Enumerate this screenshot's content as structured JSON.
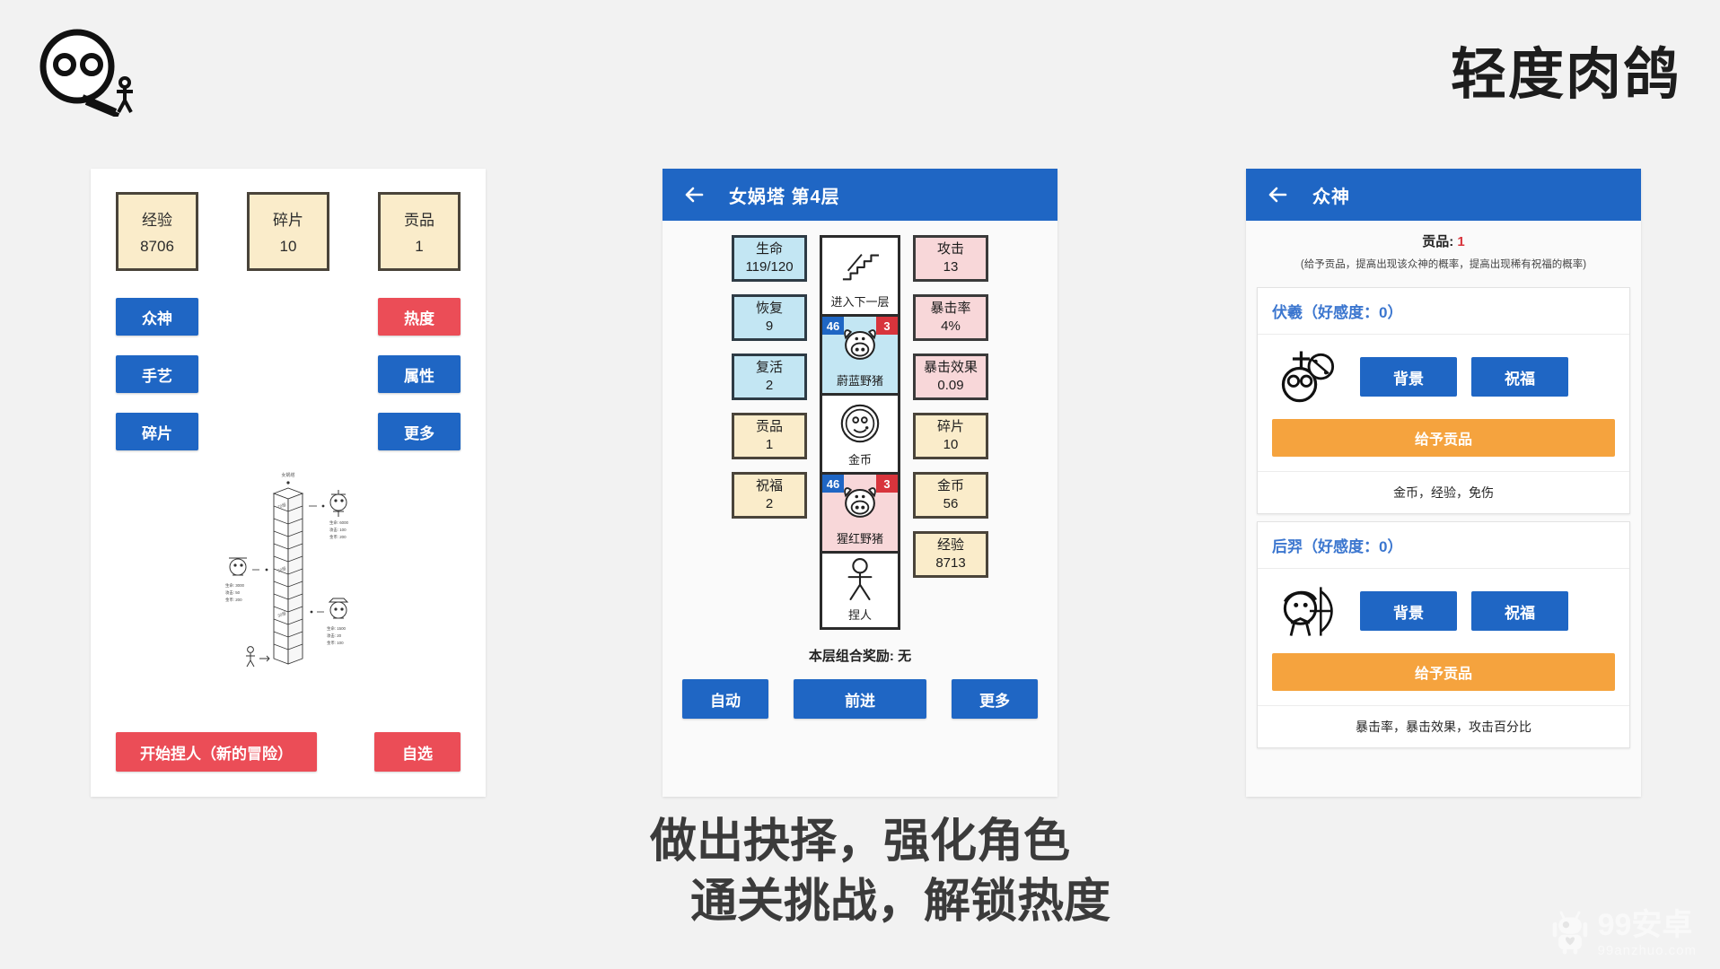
{
  "brand": {
    "title": "轻度肉鸽",
    "logo_icon": "stickman-head-logo-icon"
  },
  "panel1": {
    "stats": [
      {
        "label": "经验",
        "value": "8706"
      },
      {
        "label": "碎片",
        "value": "10"
      },
      {
        "label": "贡品",
        "value": "1"
      }
    ],
    "menu_rows": [
      {
        "left": "众神",
        "right": "热度",
        "right_style": "red"
      },
      {
        "left": "手艺",
        "right": "属性",
        "right_style": "blue"
      },
      {
        "left": "碎片",
        "right": "更多",
        "right_style": "blue"
      }
    ],
    "tower": {
      "top_label": "女娲塔",
      "floor_labels": [
        "70层",
        "50层",
        "30层"
      ],
      "monsters": [
        {
          "hp": "生命: 6000",
          "atk": "攻击: 100",
          "gold": "金币: 200"
        },
        {
          "hp": "生命: 3000",
          "atk": "攻击: 50",
          "gold": "金币: 200"
        },
        {
          "hp": "生命: 1500",
          "atk": "攻击: 20",
          "gold": "金币: 100"
        }
      ]
    },
    "footer": {
      "primary": "开始捏人（新的冒险）",
      "secondary": "自选"
    }
  },
  "panel2": {
    "appbar": {
      "title": "女娲塔 第4层",
      "back_icon": "back-arrow-icon"
    },
    "left_cells": [
      {
        "label": "生命",
        "value": "119/120",
        "style": "blue"
      },
      {
        "label": "恢复",
        "value": "9",
        "style": "blue"
      },
      {
        "label": "复活",
        "value": "2",
        "style": "blue"
      },
      {
        "label": "贡品",
        "value": "1",
        "style": "cream"
      },
      {
        "label": "祝福",
        "value": "2",
        "style": "cream"
      }
    ],
    "right_cells": [
      {
        "label": "攻击",
        "value": "13",
        "style": "pink"
      },
      {
        "label": "暴击率",
        "value": "4%",
        "style": "pink"
      },
      {
        "label": "暴击效果",
        "value": "0.09",
        "style": "pink"
      },
      {
        "label": "碎片",
        "value": "10",
        "style": "cream"
      },
      {
        "label": "金币",
        "value": "56",
        "style": "cream"
      },
      {
        "label": "经验",
        "value": "8713",
        "style": "cream"
      }
    ],
    "tiles": [
      {
        "caption": "进入下一层",
        "icon": "stairs-icon",
        "style": "white",
        "left_badge": "",
        "right_badge": ""
      },
      {
        "caption": "蔚蓝野猪",
        "icon": "boar-icon",
        "style": "blue",
        "left_badge": "46",
        "right_badge": "3"
      },
      {
        "caption": "金币",
        "icon": "coin-icon",
        "style": "white",
        "left_badge": "",
        "right_badge": ""
      },
      {
        "caption": "猩红野猪",
        "icon": "boar-icon",
        "style": "pink",
        "left_badge": "46",
        "right_badge": "3"
      },
      {
        "caption": "捏人",
        "icon": "stickman-icon",
        "style": "white",
        "left_badge": "",
        "right_badge": ""
      }
    ],
    "note": "本层组合奖励: 无",
    "buttons": {
      "auto": "自动",
      "advance": "前进",
      "more": "更多"
    }
  },
  "panel3": {
    "appbar": {
      "title": "众神",
      "back_icon": "back-arrow-icon"
    },
    "tribute_label": "贡品:",
    "tribute_value": "1",
    "hint": "(给予贡品，提高出现该众神的概率，提高出现稀有祝福的概率)",
    "gods": [
      {
        "name": "伏羲（好感度：0）",
        "avatar_icon": "fuxi-compass-icon",
        "background_button": "背景",
        "blessing_button": "祝福",
        "tribute_button": "给予贡品",
        "effects": "金币，经验，免伤"
      },
      {
        "name": "后羿（好感度：0）",
        "avatar_icon": "houyi-bow-icon",
        "background_button": "背景",
        "blessing_button": "祝福",
        "tribute_button": "给予贡品",
        "effects": "暴击率，暴击效果，攻击百分比"
      }
    ]
  },
  "caption": {
    "line1": "做出抉择，强化角色",
    "line2": "通关挑战，解锁热度"
  },
  "watermark": {
    "line1": "99安卓",
    "line2": "99anzhuo.com",
    "icon": "android-robot-icon"
  },
  "colors": {
    "primary_blue": "#1f66c4",
    "red": "#eb4d57",
    "orange": "#f5a33e",
    "cream": "#faecca",
    "cell_blue": "#c3e6f3",
    "cell_pink": "#f8d7d9",
    "page_bg": "#f2f2f2"
  }
}
